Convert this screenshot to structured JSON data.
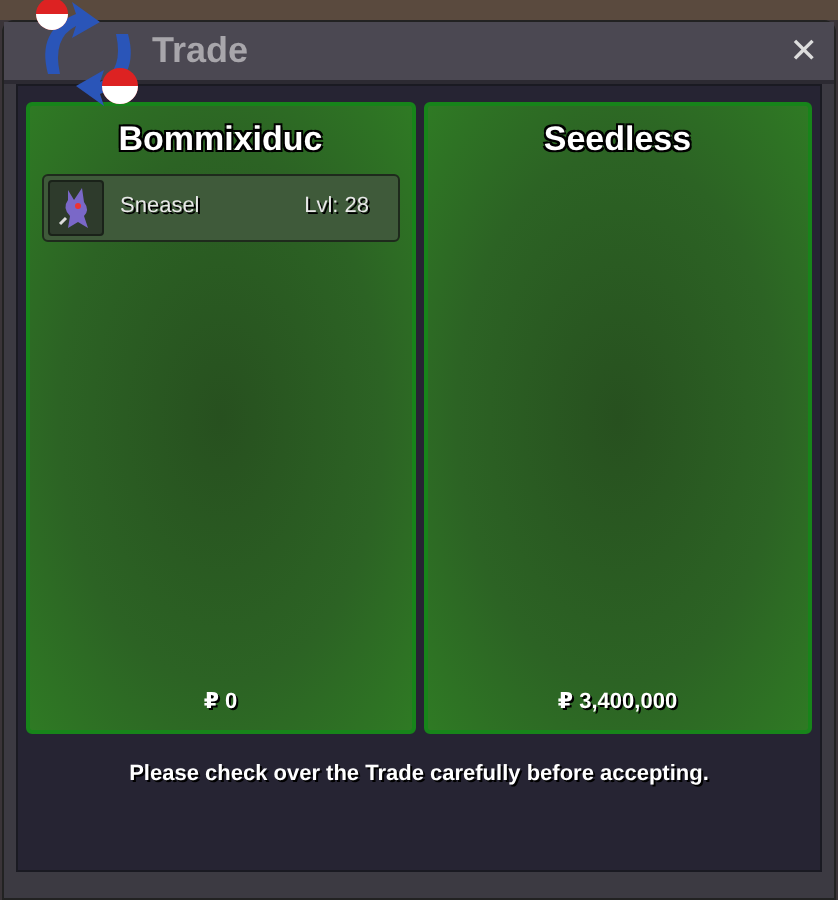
{
  "window": {
    "title": "Trade",
    "close": "✕"
  },
  "traders": [
    {
      "name": "Bommixiduc",
      "items": [
        {
          "name": "Sneasel",
          "level": "Lvl: 28"
        }
      ],
      "money": "₽ 0"
    },
    {
      "name": "Seedless",
      "money": "₽ 3,400,000"
    }
  ],
  "message": "Please check over the Trade carefully before accepting."
}
